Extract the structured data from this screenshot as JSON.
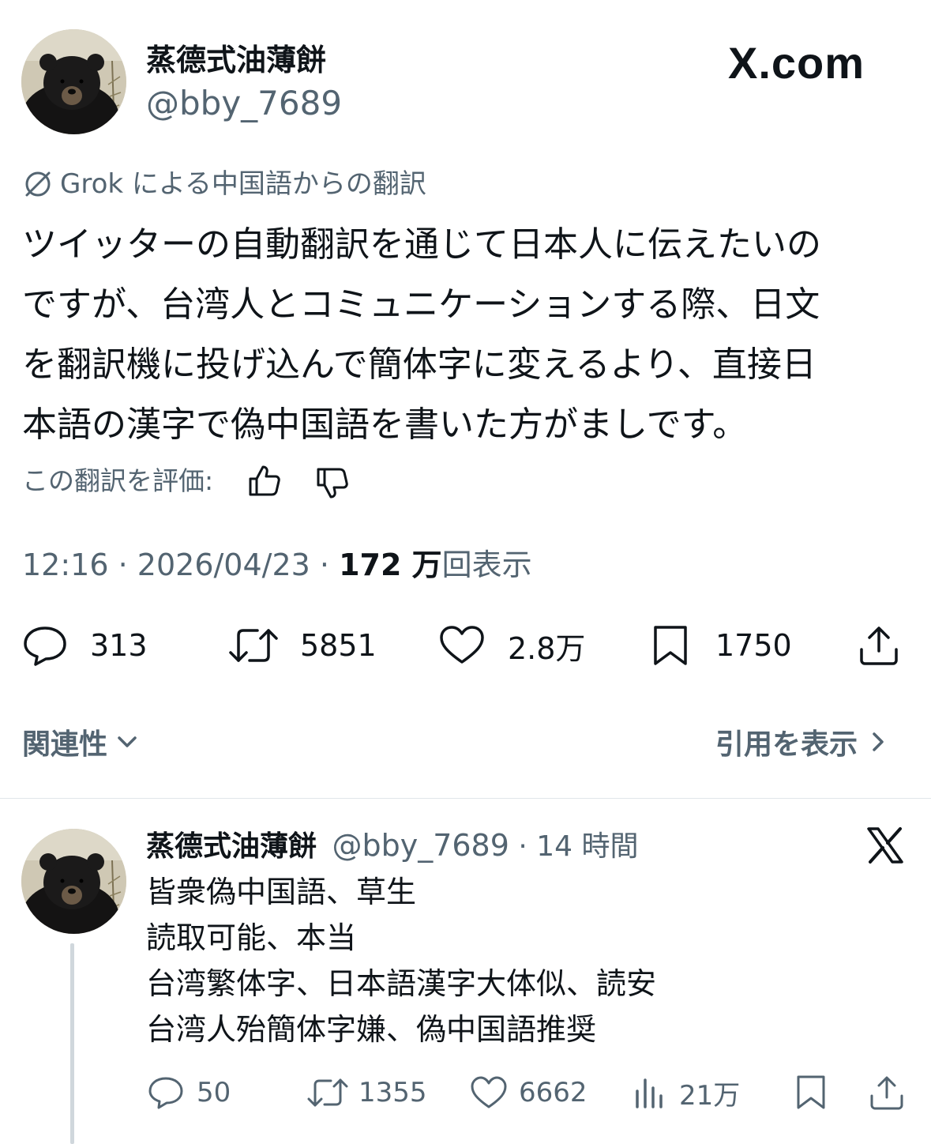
{
  "main_tweet": {
    "author_name": "蒸德式油薄餅",
    "handle": "@bby_7689",
    "site_label": "X.com",
    "translation_label": "Grok による中国語からの翻訳",
    "text_lines": [
      "ツイッターの自動翻訳を通じて日本人に伝えたいの",
      "ですが、台湾人とコミュニケーションする際、日文",
      "を翻訳機に投げ込んで簡体字に変えるより、直接日",
      "本語の漢字で偽中国語を書いた方がましです。"
    ],
    "rate_label": "この翻訳を評価:",
    "time": "12:16",
    "date": "2026/04/23",
    "views_count": "172 万",
    "views_label": "回表示",
    "separator": "·",
    "actions": {
      "replies": "313",
      "reposts": "5851",
      "likes": "2.8万",
      "bookmarks": "1750"
    },
    "sort_label": "関連性",
    "quotes_link": "引用を表示"
  },
  "reply_tweet": {
    "author_name": "蒸德式油薄餅",
    "handle": "@bby_7689",
    "separator": "·",
    "time_ago": "14 時間",
    "text_lines": [
      "皆衆偽中国語、草生",
      "読取可能、本当",
      "台湾繁体字、日本語漢字大体似、読安",
      "台湾人殆簡体字嫌、偽中国語推奨"
    ],
    "actions": {
      "replies": "50",
      "reposts": "1355",
      "likes": "6662",
      "views": "21万"
    }
  },
  "icons": {
    "translate": "grok-slash-icon",
    "thumbs_up": "thumbs-up-icon",
    "thumbs_down": "thumbs-down-icon",
    "reply": "reply-bubble-icon",
    "repost": "repost-icon",
    "like": "heart-icon",
    "bookmark": "bookmark-icon",
    "share": "share-icon",
    "views": "bar-chart-icon",
    "chevron_down": "chevron-down-icon",
    "chevron_right": "chevron-right-icon",
    "x_logo": "x-logo-icon"
  },
  "colors": {
    "text": "#0f1419",
    "secondary": "#536471",
    "divider": "#e1e6ea",
    "background": "#ffffff"
  }
}
